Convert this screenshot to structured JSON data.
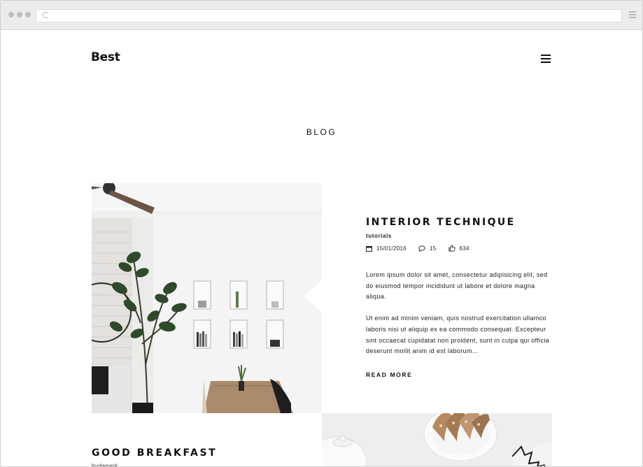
{
  "browser": {
    "address": ""
  },
  "site": {
    "logo": "Best"
  },
  "section": {
    "title": "BLOG"
  },
  "posts": [
    {
      "title": "INTERIOR TECHNIQUE",
      "category": "tutorials",
      "date": "15/01/2016",
      "comments": "15",
      "likes": "634",
      "paragraphs": [
        "Lorem ipsum dolor sit amet, consectetur adipisicing elit, sed do eiusmod tempor incididunt ut labore et dolore magna aliqua.",
        "Ut enim ad minim veniam, quis nostrud exercitation ullamco laboris nisi ut aliquip ex ea commodo consequat. Excepteur sint occaecat cupidatat non proident, sunt in culpa qui officia deserunt mollit anim id est laborum..."
      ],
      "read_more": "READ MORE"
    },
    {
      "title": "GOOD BREAKFAST",
      "category": "hydepark"
    }
  ],
  "icons": {
    "calendar": "calendar-icon",
    "comment": "comment-icon",
    "like": "thumbs-up-icon",
    "menu": "hamburger-menu-icon"
  },
  "colors": {
    "text": "#111111",
    "background": "#ffffff",
    "chrome": "#ececec"
  }
}
